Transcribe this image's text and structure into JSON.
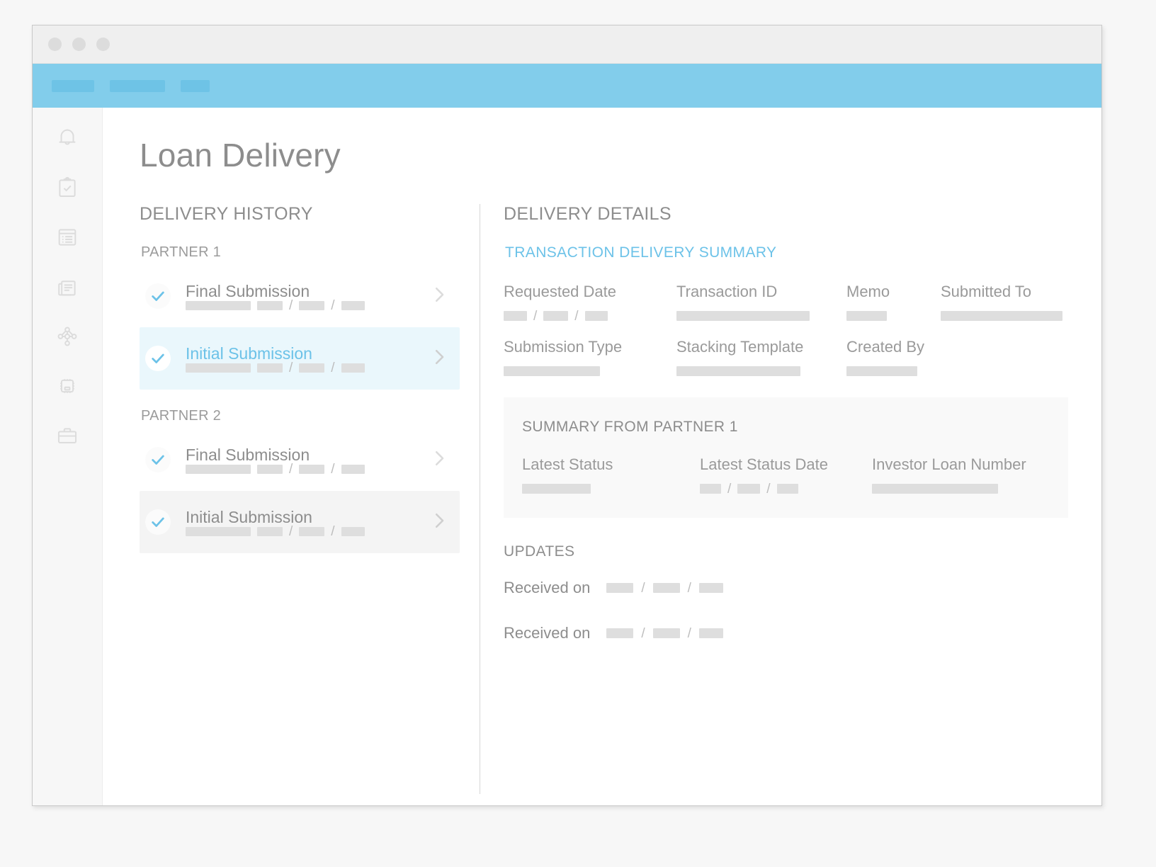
{
  "window": {
    "traffic_lights": [
      "close",
      "minimize",
      "maximize"
    ],
    "accent_color": "#82cdeb",
    "navbar_blocks": [
      "nav-block-1",
      "nav-block-2",
      "nav-block-3"
    ]
  },
  "sidebar": {
    "items": [
      {
        "icon": "bell-icon",
        "name": "notifications"
      },
      {
        "icon": "clipboard-check-icon",
        "name": "tasks"
      },
      {
        "icon": "list-document-icon",
        "name": "orders"
      },
      {
        "icon": "documents-icon",
        "name": "documents"
      },
      {
        "icon": "network-nodes-icon",
        "name": "integrations"
      },
      {
        "icon": "chip-icon",
        "name": "processing"
      },
      {
        "icon": "briefcase-icon",
        "name": "portfolio"
      }
    ]
  },
  "page": {
    "title": "Loan Delivery"
  },
  "delivery_history": {
    "heading": "DELIVERY HISTORY",
    "groups": [
      {
        "label": "PARTNER 1",
        "items": [
          {
            "title": "Final Submission",
            "state": "default",
            "checked": true,
            "chevron": "chevron-right-icon"
          },
          {
            "title": "Initial Submission",
            "state": "selected",
            "checked": true,
            "chevron": "chevron-right-icon"
          }
        ]
      },
      {
        "label": "PARTNER 2",
        "items": [
          {
            "title": "Final Submission",
            "state": "default",
            "checked": true,
            "chevron": "chevron-right-icon"
          },
          {
            "title": "Initial Submission",
            "state": "hovered",
            "checked": true,
            "chevron": "chevron-right-icon"
          }
        ]
      }
    ]
  },
  "delivery_details": {
    "heading": "DELIVERY DETAILS",
    "summary_heading": "TRANSACTION DELIVERY SUMMARY",
    "fields_row1": [
      {
        "label": "Requested Date",
        "value_type": "date-placeholder"
      },
      {
        "label": "Transaction ID",
        "value_type": "bar-placeholder"
      },
      {
        "label": "Memo",
        "value_type": "bar-placeholder"
      },
      {
        "label": "Submitted To",
        "value_type": "bar-placeholder"
      }
    ],
    "fields_row2": [
      {
        "label": "Submission Type",
        "value_type": "bar-placeholder"
      },
      {
        "label": "Stacking Template",
        "value_type": "bar-placeholder"
      },
      {
        "label": "Created By",
        "value_type": "bar-placeholder"
      }
    ],
    "summary_box": {
      "title": "SUMMARY FROM PARTNER 1",
      "fields": [
        {
          "label": "Latest Status",
          "value_type": "bar-placeholder"
        },
        {
          "label": "Latest Status Date",
          "value_type": "date-placeholder"
        },
        {
          "label": "Investor Loan Number",
          "value_type": "bar-placeholder"
        }
      ]
    },
    "updates": {
      "title": "UPDATES",
      "rows": [
        {
          "label": "Received on",
          "value_type": "date-placeholder"
        },
        {
          "label": "Received on",
          "value_type": "date-placeholder"
        }
      ]
    }
  },
  "glyphs": {
    "slash": "/"
  }
}
